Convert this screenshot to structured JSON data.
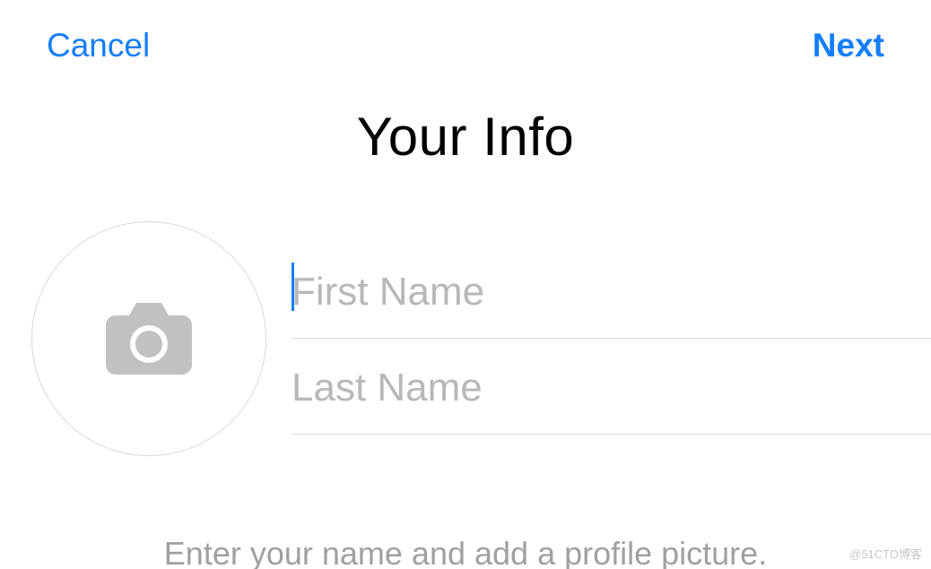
{
  "header": {
    "cancel_label": "Cancel",
    "next_label": "Next"
  },
  "title": "Your Info",
  "fields": {
    "first_name_placeholder": "First Name",
    "first_name_value": "",
    "last_name_placeholder": "Last Name",
    "last_name_value": ""
  },
  "hint": "Enter your name and add a profile picture.",
  "watermark": "@51CTO博客",
  "colors": {
    "accent": "#157efb",
    "placeholder": "#b8b8b8",
    "border": "#d9d9d9",
    "text": "#000000",
    "hint": "#a0a0a0",
    "icon": "#c1c1c1"
  }
}
